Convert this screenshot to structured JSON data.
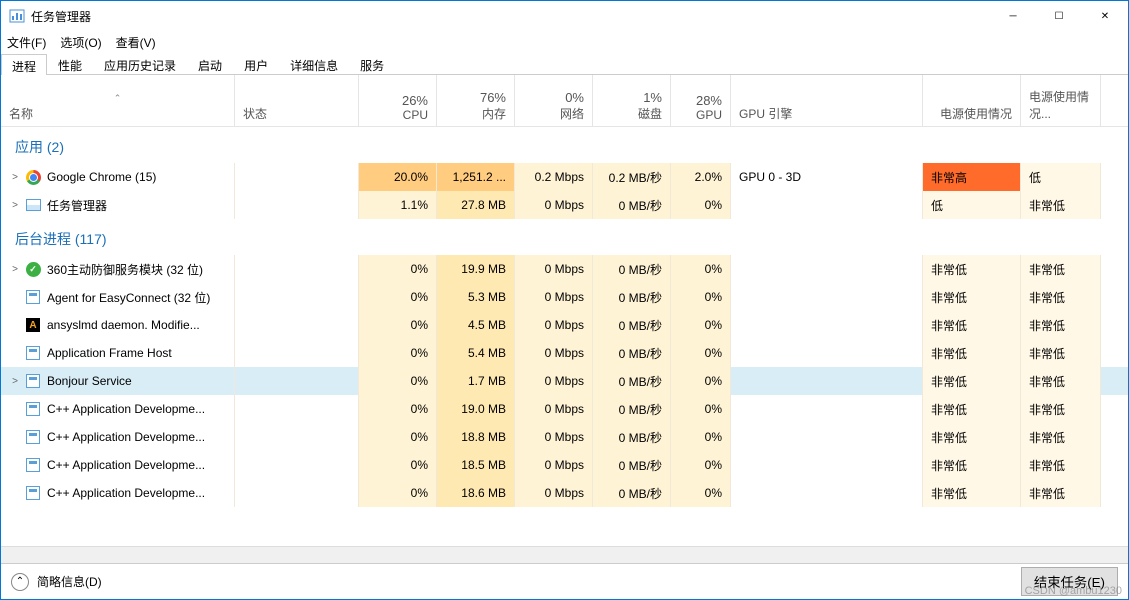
{
  "window": {
    "title": "任务管理器"
  },
  "menu": {
    "file": "文件(F)",
    "options": "选项(O)",
    "view": "查看(V)"
  },
  "tabs": [
    "进程",
    "性能",
    "应用历史记录",
    "启动",
    "用户",
    "详细信息",
    "服务"
  ],
  "active_tab_index": 0,
  "columns": {
    "name": "名称",
    "status": "状态",
    "cpu": {
      "pct": "26%",
      "label": "CPU"
    },
    "mem": {
      "pct": "76%",
      "label": "内存"
    },
    "net": {
      "pct": "0%",
      "label": "网络"
    },
    "disk": {
      "pct": "1%",
      "label": "磁盘"
    },
    "gpu": {
      "pct": "28%",
      "label": "GPU"
    },
    "gpu_engine": "GPU 引擎",
    "power": "电源使用情况",
    "power_trend": "电源使用情况..."
  },
  "groups": {
    "apps": {
      "title": "应用 (2)"
    },
    "background": {
      "title": "后台进程 (117)"
    }
  },
  "processes": {
    "apps": [
      {
        "name": "Google Chrome (15)",
        "icon": "chrome",
        "expandable": true,
        "cpu": "20.0%",
        "mem": "1,251.2 ...",
        "net": "0.2 Mbps",
        "disk": "0.2 MB/秒",
        "gpu": "2.0%",
        "gpu_engine": "GPU 0 - 3D",
        "power": "非常高",
        "power_trend": "低",
        "highlight": "chrome"
      },
      {
        "name": "任务管理器",
        "icon": "tm",
        "expandable": true,
        "cpu": "1.1%",
        "mem": "27.8 MB",
        "net": "0 Mbps",
        "disk": "0 MB/秒",
        "gpu": "0%",
        "gpu_engine": "",
        "power": "低",
        "power_trend": "非常低"
      }
    ],
    "background": [
      {
        "name": "360主动防御服务模块 (32 位)",
        "icon": "360",
        "expandable": true,
        "cpu": "0%",
        "mem": "19.9 MB",
        "net": "0 Mbps",
        "disk": "0 MB/秒",
        "gpu": "0%",
        "gpu_engine": "",
        "power": "非常低",
        "power_trend": "非常低"
      },
      {
        "name": "Agent for EasyConnect (32 位)",
        "icon": "generic",
        "expandable": false,
        "cpu": "0%",
        "mem": "5.3 MB",
        "net": "0 Mbps",
        "disk": "0 MB/秒",
        "gpu": "0%",
        "gpu_engine": "",
        "power": "非常低",
        "power_trend": "非常低"
      },
      {
        "name": "ansyslmd daemon.  Modifie...",
        "icon": "ansys",
        "expandable": false,
        "cpu": "0%",
        "mem": "4.5 MB",
        "net": "0 Mbps",
        "disk": "0 MB/秒",
        "gpu": "0%",
        "gpu_engine": "",
        "power": "非常低",
        "power_trend": "非常低"
      },
      {
        "name": "Application Frame Host",
        "icon": "generic",
        "expandable": false,
        "cpu": "0%",
        "mem": "5.4 MB",
        "net": "0 Mbps",
        "disk": "0 MB/秒",
        "gpu": "0%",
        "gpu_engine": "",
        "power": "非常低",
        "power_trend": "非常低"
      },
      {
        "name": "Bonjour Service",
        "icon": "generic",
        "expandable": true,
        "selected": true,
        "cpu": "0%",
        "mem": "1.7 MB",
        "net": "0 Mbps",
        "disk": "0 MB/秒",
        "gpu": "0%",
        "gpu_engine": "",
        "power": "非常低",
        "power_trend": "非常低"
      },
      {
        "name": "C++ Application Developme...",
        "icon": "generic",
        "expandable": false,
        "cpu": "0%",
        "mem": "19.0 MB",
        "net": "0 Mbps",
        "disk": "0 MB/秒",
        "gpu": "0%",
        "gpu_engine": "",
        "power": "非常低",
        "power_trend": "非常低"
      },
      {
        "name": "C++ Application Developme...",
        "icon": "generic",
        "expandable": false,
        "cpu": "0%",
        "mem": "18.8 MB",
        "net": "0 Mbps",
        "disk": "0 MB/秒",
        "gpu": "0%",
        "gpu_engine": "",
        "power": "非常低",
        "power_trend": "非常低"
      },
      {
        "name": "C++ Application Developme...",
        "icon": "generic",
        "expandable": false,
        "cpu": "0%",
        "mem": "18.5 MB",
        "net": "0 Mbps",
        "disk": "0 MB/秒",
        "gpu": "0%",
        "gpu_engine": "",
        "power": "非常低",
        "power_trend": "非常低"
      },
      {
        "name": "C++ Application Developme...",
        "icon": "generic",
        "expandable": false,
        "cpu": "0%",
        "mem": "18.6 MB",
        "net": "0 Mbps",
        "disk": "0 MB/秒",
        "gpu": "0%",
        "gpu_engine": "",
        "power": "非常低",
        "power_trend": "非常低"
      }
    ]
  },
  "footer": {
    "brief": "简略信息(D)",
    "end_task": "结束任务(E)"
  },
  "watermark": "CSDN @ambu1230"
}
